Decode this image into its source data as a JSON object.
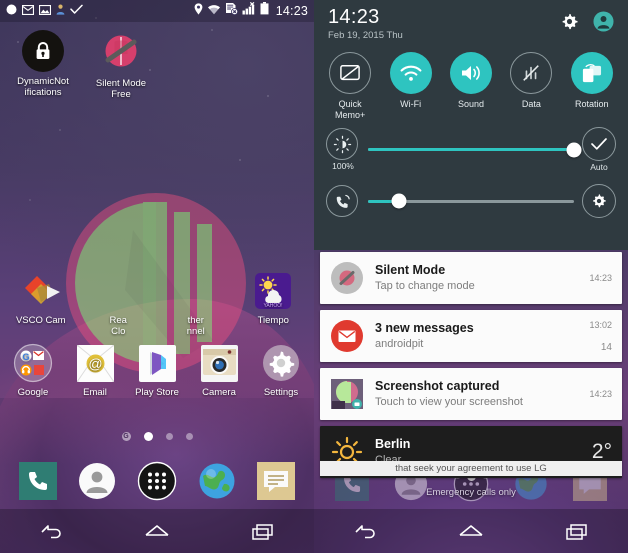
{
  "left_screen": {
    "status_bar": {
      "left_icons": [
        "circle-icon",
        "mail-icon",
        "image-icon",
        "person-icon",
        "checkmark-icon"
      ],
      "right_icons": [
        "location-pin-icon",
        "wifi-icon",
        "sync-error-icon",
        "signal-bars-icon",
        "battery-icon"
      ],
      "clock": "14:23"
    },
    "widgets": [
      {
        "label": "DynamicNotifications",
        "icon": "lock-icon"
      },
      {
        "label": "Silent Mode\nFree",
        "icon": "silent-mode-icon"
      }
    ],
    "widget_labels": {
      "dynamic_notifications_line1": "DynamicNot",
      "dynamic_notifications_line2": "ifications",
      "silent_mode_line1": "Silent Mode",
      "silent_mode_line2": "Free"
    },
    "shortcut_row": [
      {
        "label": "VSCO Cam",
        "icon": "vsco-cam-icon"
      },
      {
        "label_line1": "Rea",
        "label_line2": "Clo",
        "label": "Readly Cloud",
        "icon": "readly-icon"
      },
      {
        "label_line1": "ther",
        "label_line2": "nnel",
        "label": "Weather Channel",
        "icon": "weather-channel-icon"
      },
      {
        "label": "Tiempo",
        "icon": "yahoo-weather-icon"
      }
    ],
    "app_row": [
      {
        "label": "Google",
        "icon": "google-folder-icon"
      },
      {
        "label": "Email",
        "icon": "email-icon"
      },
      {
        "label": "Play Store",
        "icon": "play-store-icon"
      },
      {
        "label": "Camera",
        "icon": "camera-icon"
      },
      {
        "label": "Settings",
        "icon": "settings-gear-icon"
      }
    ],
    "page_indicator": {
      "google_now_label": "G",
      "pages": 3,
      "active_page": 2
    },
    "dock": [
      {
        "name": "phone-icon",
        "label": "Phone"
      },
      {
        "name": "contacts-icon",
        "label": "Contacts"
      },
      {
        "name": "app-drawer-icon",
        "label": "Apps"
      },
      {
        "name": "browser-icon",
        "label": "Browser"
      },
      {
        "name": "messaging-icon",
        "label": "Messaging"
      }
    ],
    "nav_bar": [
      {
        "name": "back-button",
        "label": "Back"
      },
      {
        "name": "home-button",
        "label": "Home"
      },
      {
        "name": "recents-button",
        "label": "Recent apps"
      }
    ]
  },
  "right_screen": {
    "header": {
      "time": "14:23",
      "date": "Feb 19, 2015 Thu",
      "settings_icon": "gear-icon",
      "profile_icon": "user-profile-icon"
    },
    "quick_settings": [
      {
        "label": "Quick\nMemo+",
        "label_line1": "Quick",
        "label_line2": "Memo+",
        "icon": "quick-memo-icon",
        "active": false
      },
      {
        "label": "Wi-Fi",
        "icon": "wifi-icon",
        "active": true
      },
      {
        "label": "Sound",
        "icon": "sound-icon",
        "active": true
      },
      {
        "label": "Data",
        "icon": "data-off-icon",
        "active": false
      },
      {
        "label": "Rotation",
        "icon": "rotation-icon",
        "active": true
      }
    ],
    "brightness_slider": {
      "icon": "brightness-icon",
      "value_label": "100%",
      "value": 100,
      "end_icon": "check-icon",
      "end_label": "Auto"
    },
    "volume_slider": {
      "icon": "ringer-volume-icon",
      "value": 15,
      "end_icon": "gear-icon",
      "end_label": ""
    },
    "notifications": [
      {
        "icon": "silent-mode-icon",
        "title": "Silent Mode",
        "subtitle": "Tap to change mode",
        "time": "14:23",
        "count": "",
        "theme": "light"
      },
      {
        "icon": "gmail-icon",
        "title": "3 new messages",
        "subtitle": "androidpit",
        "time": "13:02",
        "count": "14",
        "theme": "light"
      },
      {
        "icon": "screenshot-thumb-icon",
        "title": "Screenshot captured",
        "subtitle": "Touch to view your screenshot",
        "time": "14:23",
        "count": "",
        "theme": "light"
      },
      {
        "icon": "sun-icon",
        "title": "Berlin",
        "subtitle": "Clear",
        "temperature": "2°",
        "time": "",
        "count": "",
        "theme": "dark"
      }
    ],
    "eula_banner": "that seek your agreement to use LG",
    "emergency_text": "Emergency calls only",
    "nav_bar": [
      {
        "name": "back-button",
        "label": "Back"
      },
      {
        "name": "home-button",
        "label": "Home"
      },
      {
        "name": "recents-button",
        "label": "Recent apps"
      }
    ]
  },
  "colors": {
    "accent_teal": "#2ec4c0",
    "shade_bg": "#2f3a40",
    "notification_light": "#fbfbfb",
    "notification_dark": "#1d1d1d",
    "wallpaper_purple": "#5b4079",
    "logo_pink": "#e8567f",
    "logo_green": "#9ee87a"
  }
}
